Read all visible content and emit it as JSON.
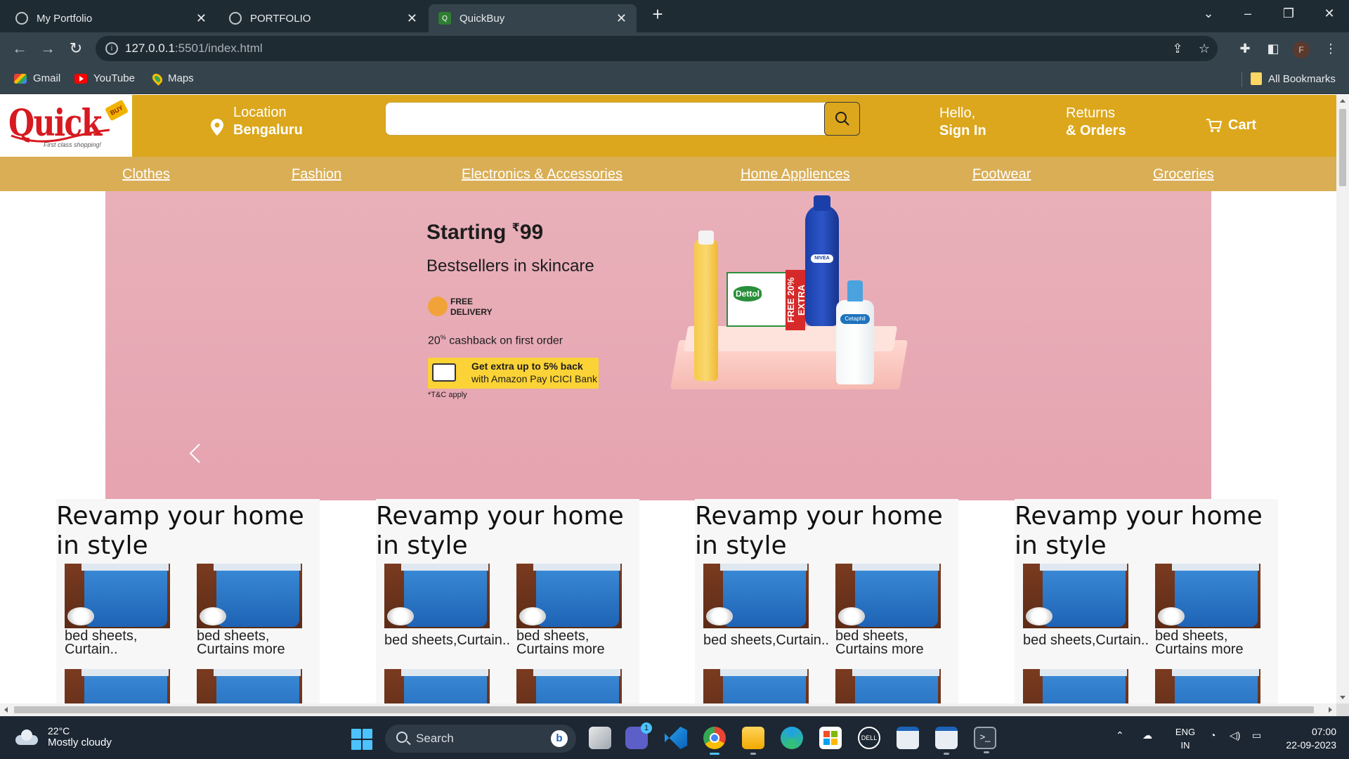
{
  "browser": {
    "tabs": [
      {
        "title": "My Portfolio",
        "active": false
      },
      {
        "title": "PORTFOLIO",
        "active": false
      },
      {
        "title": "QuickBuy",
        "active": true
      }
    ],
    "url_host": "127.0.0.1",
    "url_rest": ":5501/index.html",
    "bookmarks": [
      {
        "label": "Gmail",
        "icon": "gmail-icon"
      },
      {
        "label": "YouTube",
        "icon": "youtube-icon"
      },
      {
        "label": "Maps",
        "icon": "maps-icon"
      }
    ],
    "all_bookmarks": "All Bookmarks",
    "profile_initial": "F"
  },
  "site": {
    "logo_text": "Quick",
    "logo_badge": "BUY",
    "logo_tagline": "First class shopping!",
    "location_label": "Location",
    "location_value": "Bengaluru",
    "search_placeholder": "",
    "greeting": "Hello,",
    "sign_in": "Sign In",
    "returns": "Returns",
    "orders": "& Orders",
    "cart": "Cart",
    "categories": [
      "Clothes",
      "Fashion",
      "Electronics & Accessories",
      "Home Appliences",
      "Footwear",
      "Groceries"
    ],
    "colors": {
      "header": "#dca71c",
      "category_bar": "#d9ae55",
      "banner": "#e9b0b9"
    }
  },
  "banner": {
    "headline": "Starting ",
    "currency": "₹",
    "price": "99",
    "subheadline": "Bestsellers in skincare",
    "delivery_line1": "FREE",
    "delivery_line2": "DELIVERY",
    "cashback_num": "20",
    "cashback_pct": "%",
    "cashback_text": " cashback on first order",
    "offer_line1": "Get extra up to 5% back",
    "offer_line2": "with Amazon Pay ICICI Bank",
    "tc": "*T&C apply",
    "product_labels": {
      "dettol": "Dettol",
      "free": "FREE 20% EXTRA",
      "nivea": "NIVEA",
      "cetaphil": "Cetaphil"
    }
  },
  "cards": [
    {
      "title": "Revamp your home in style",
      "tiles": [
        "bed sheets, Curtain..",
        "bed sheets, Curtains more",
        "",
        ""
      ]
    },
    {
      "title": "Revamp your home in style",
      "tiles": [
        "bed sheets,Curtain..",
        "bed sheets, Curtains more",
        "",
        ""
      ]
    },
    {
      "title": "Revamp your home in style",
      "tiles": [
        "bed sheets,Curtain..",
        "bed sheets, Curtains more",
        "",
        ""
      ]
    },
    {
      "title": "Revamp your home in style",
      "tiles": [
        "bed sheets,Curtain..",
        "bed sheets, Curtains more",
        "",
        ""
      ]
    }
  ],
  "taskbar": {
    "temperature": "22°C",
    "weather": "Mostly cloudy",
    "search": "Search",
    "lang1": "ENG",
    "lang2": "IN",
    "time": "07:00",
    "date": "22-09-2023",
    "teams_badge": "1"
  }
}
